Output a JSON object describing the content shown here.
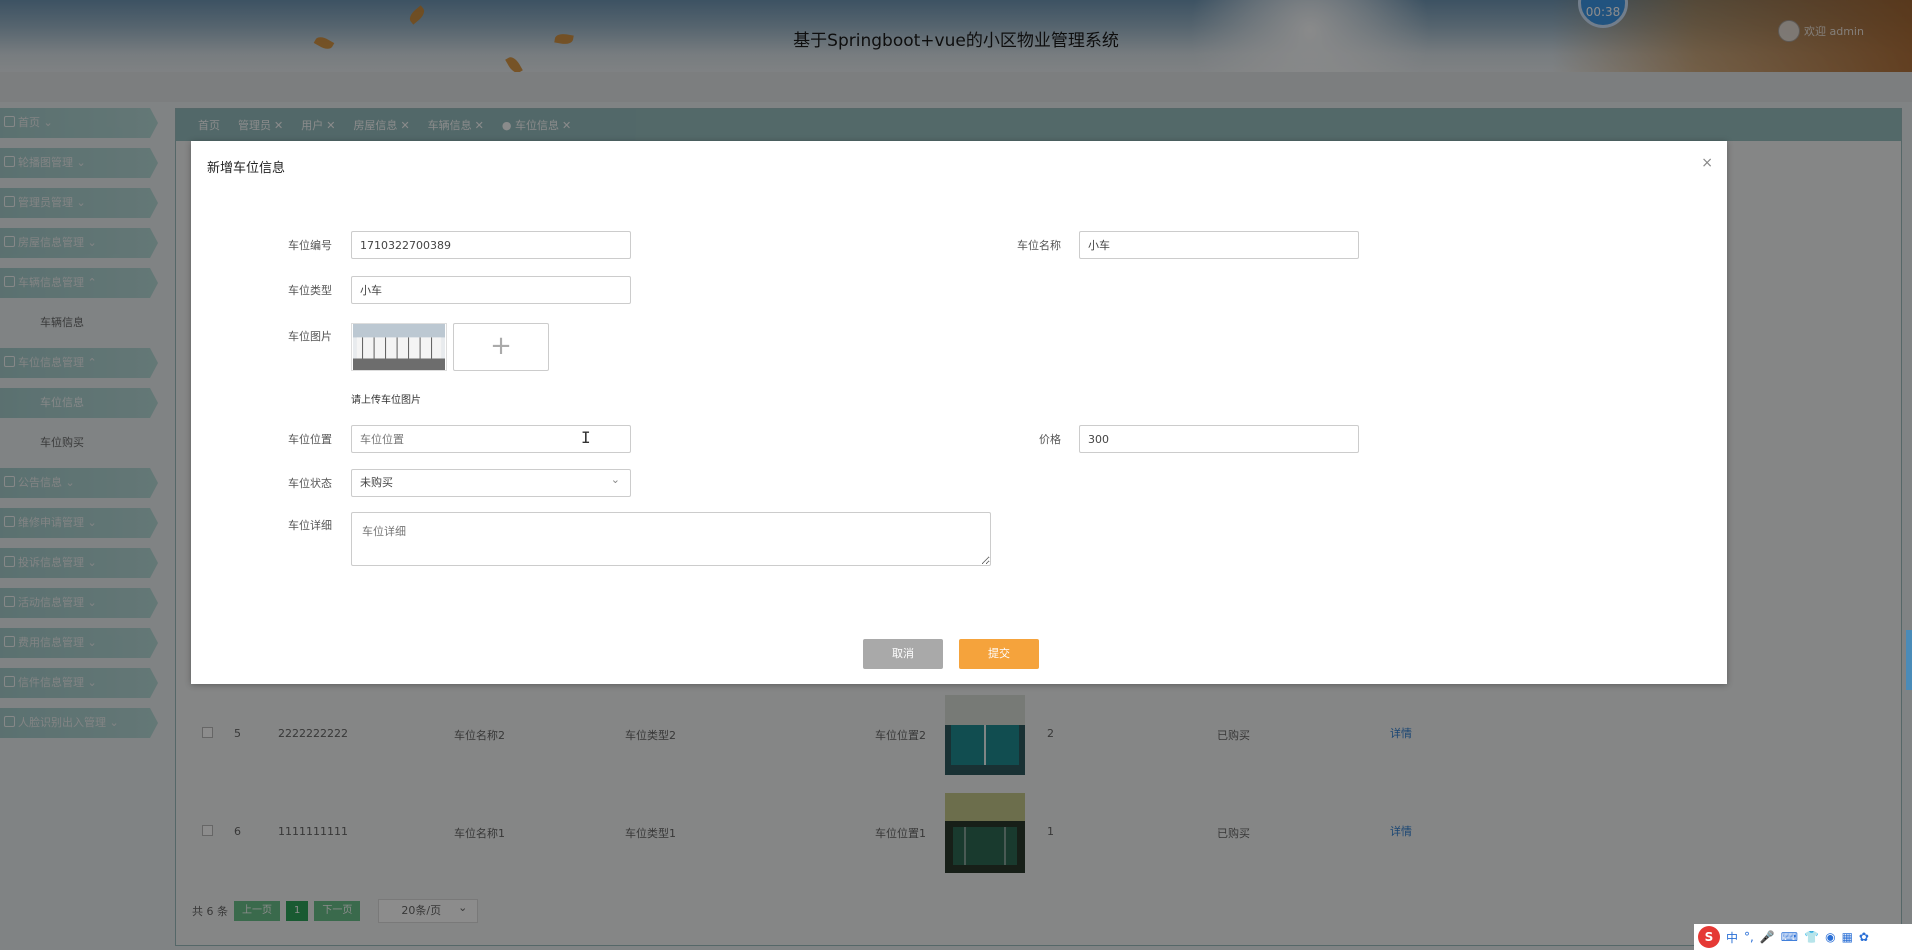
{
  "header": {
    "title": "基于Springboot+vue的小区物业管理系统",
    "timer": "00:38",
    "user_label": "欢迎 admin"
  },
  "sidebar": {
    "items": [
      {
        "label": "首页"
      },
      {
        "label": "轮播图管理"
      },
      {
        "label": "管理员管理"
      },
      {
        "label": "房屋信息管理"
      },
      {
        "label": "车辆信息管理"
      },
      {
        "label": "车辆信息",
        "sub": true
      },
      {
        "label": "车位信息管理"
      },
      {
        "label": "车位信息",
        "sub": true,
        "active": true
      },
      {
        "label": "车位购买",
        "sub": true
      },
      {
        "label": "公告信息"
      },
      {
        "label": "维修申请管理"
      },
      {
        "label": "投诉信息管理"
      },
      {
        "label": "活动信息管理"
      },
      {
        "label": "费用信息管理"
      },
      {
        "label": "信件信息管理"
      },
      {
        "label": "人脸识别出入管理"
      }
    ]
  },
  "tabs": [
    "首页",
    "管理员",
    "用户",
    "房屋信息",
    "车辆信息",
    "车位信息"
  ],
  "table": {
    "rows": [
      {
        "no": "5",
        "code": "2222222222",
        "name": "车位名称2",
        "type": "车位类型2",
        "location": "车位位置2",
        "price": "2",
        "status": "已购买",
        "action": "详情"
      },
      {
        "no": "6",
        "code": "1111111111",
        "name": "车位名称1",
        "type": "车位类型1",
        "location": "车位位置1",
        "price": "1",
        "status": "已购买",
        "action": "详情"
      }
    ]
  },
  "pager": {
    "total": "共 6 条",
    "prev": "上一页",
    "current": "1",
    "next": "下一页",
    "size": "20条/页"
  },
  "dialog": {
    "title": "新增车位信息",
    "close": "×",
    "fields": {
      "code_label": "车位编号",
      "code_value": "1710322700389",
      "name_label": "车位名称",
      "name_value": "小车",
      "type_label": "车位类型",
      "type_value": "小车",
      "image_label": "车位图片",
      "image_hint": "请上传车位图片",
      "image_add": "+",
      "location_label": "车位位置",
      "location_placeholder": "车位位置",
      "price_label": "价格",
      "price_value": "300",
      "status_label": "车位状态",
      "status_value": "未购买",
      "detail_label": "车位详细",
      "detail_placeholder": "车位详细"
    },
    "cancel": "取消",
    "submit": "提交"
  },
  "ime": {
    "lang": "中"
  }
}
